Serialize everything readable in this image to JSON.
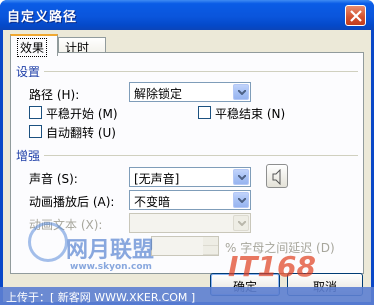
{
  "window": {
    "title": "自定义路径"
  },
  "tabs": [
    {
      "label": "效果",
      "active": true
    },
    {
      "label": "计时",
      "active": false
    }
  ],
  "settings": {
    "section_label": "设置",
    "path_label": "路径 (H):",
    "path_value": "解除锁定",
    "smooth_start_label": "平稳开始 (M)",
    "smooth_end_label": "平稳结束 (N)",
    "auto_reverse_label": "自动翻转 (U)"
  },
  "enhance": {
    "section_label": "增强",
    "sound_label": "声音 (S):",
    "sound_value": "[无声音]",
    "after_anim_label": "动画播放后 (A):",
    "after_anim_value": "不变暗",
    "anim_text_label": "动画文本 (X):",
    "delay_label": "% 字母之间延迟 (D)"
  },
  "buttons": {
    "ok": "确定",
    "cancel": "取消"
  },
  "watermark": {
    "credit": "上传于：[ 新客网 WWW.XKER.COM ]",
    "site_text": "网月联盟",
    "site_url": "www.skyon.com",
    "logo": "IT168"
  },
  "colors": {
    "titlebar": "#0a55dc",
    "dialog_bg": "#ece9d8",
    "section_text": "#1f3fa8"
  }
}
